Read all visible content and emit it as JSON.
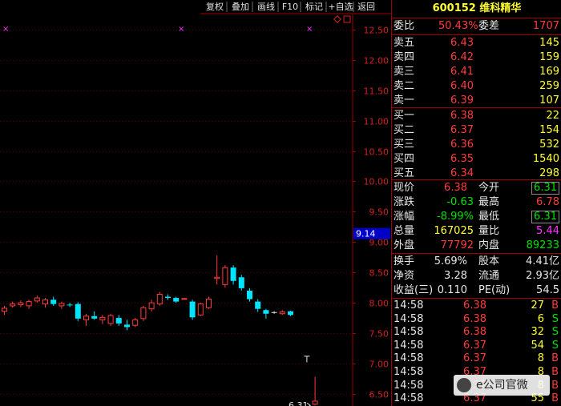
{
  "toolbar": {
    "buttons": [
      "复权",
      "叠加",
      "画线",
      "F10",
      "标记",
      "+自选",
      "返回"
    ],
    "diamond_icon": "diamond-outline-icon"
  },
  "chart_data": {
    "type": "candlestick",
    "y_ticks": [
      "12.50",
      "12.00",
      "11.50",
      "11.00",
      "10.50",
      "10.00",
      "9.50",
      "9.00",
      "8.50",
      "8.00",
      "7.50",
      "7.00",
      "6.50"
    ],
    "ylim": [
      6.3,
      12.75
    ],
    "price_marker": "9.14",
    "price_marker_value": 9.14,
    "low_label": "6.31",
    "low_value": 6.31,
    "candles": [
      {
        "o": 7.86,
        "h": 7.95,
        "l": 7.8,
        "c": 7.91
      },
      {
        "o": 7.95,
        "h": 8.02,
        "l": 7.92,
        "c": 7.98
      },
      {
        "o": 7.97,
        "h": 8.04,
        "l": 7.93,
        "c": 8.0
      },
      {
        "o": 7.95,
        "h": 8.05,
        "l": 7.9,
        "c": 8.02
      },
      {
        "o": 8.03,
        "h": 8.12,
        "l": 8.0,
        "c": 8.08
      },
      {
        "o": 7.98,
        "h": 8.08,
        "l": 7.92,
        "c": 8.05
      },
      {
        "o": 8.05,
        "h": 8.1,
        "l": 7.95,
        "c": 7.98
      },
      {
        "o": 7.95,
        "h": 8.02,
        "l": 7.9,
        "c": 7.99
      },
      {
        "o": 7.97,
        "h": 8.0,
        "l": 7.93,
        "c": 7.96
      },
      {
        "o": 7.98,
        "h": 8.01,
        "l": 7.7,
        "c": 7.74
      },
      {
        "o": 7.72,
        "h": 7.82,
        "l": 7.62,
        "c": 7.78
      },
      {
        "o": 7.78,
        "h": 7.86,
        "l": 7.72,
        "c": 7.74
      },
      {
        "o": 7.72,
        "h": 7.8,
        "l": 7.65,
        "c": 7.76
      },
      {
        "o": 7.66,
        "h": 7.82,
        "l": 7.62,
        "c": 7.79
      },
      {
        "o": 7.75,
        "h": 7.8,
        "l": 7.62,
        "c": 7.66
      },
      {
        "o": 7.64,
        "h": 7.72,
        "l": 7.55,
        "c": 7.6
      },
      {
        "o": 7.63,
        "h": 7.75,
        "l": 7.6,
        "c": 7.72
      },
      {
        "o": 7.74,
        "h": 7.95,
        "l": 7.7,
        "c": 7.92
      },
      {
        "o": 7.9,
        "h": 8.05,
        "l": 7.86,
        "c": 8.0
      },
      {
        "o": 7.98,
        "h": 8.18,
        "l": 7.95,
        "c": 8.14
      },
      {
        "o": 8.1,
        "h": 8.14,
        "l": 8.05,
        "c": 8.08
      },
      {
        "o": 8.08,
        "h": 8.1,
        "l": 8.0,
        "c": 8.02
      },
      {
        "o": 8.06,
        "h": 8.08,
        "l": 8.05,
        "c": 8.07
      },
      {
        "o": 8.02,
        "h": 8.05,
        "l": 7.72,
        "c": 7.76
      },
      {
        "o": 7.8,
        "h": 8.0,
        "l": 7.78,
        "c": 7.98
      },
      {
        "o": 7.92,
        "h": 8.1,
        "l": 7.9,
        "c": 8.06
      },
      {
        "o": 8.4,
        "h": 8.78,
        "l": 8.3,
        "c": 8.42
      },
      {
        "o": 8.3,
        "h": 8.62,
        "l": 8.25,
        "c": 8.58
      },
      {
        "o": 8.58,
        "h": 8.62,
        "l": 8.3,
        "c": 8.36
      },
      {
        "o": 8.42,
        "h": 8.46,
        "l": 8.2,
        "c": 8.24
      },
      {
        "o": 8.2,
        "h": 8.24,
        "l": 8.02,
        "c": 8.06
      },
      {
        "o": 8.02,
        "h": 8.06,
        "l": 7.85,
        "c": 7.9
      },
      {
        "o": 7.88,
        "h": 7.9,
        "l": 7.74,
        "c": 7.82
      },
      {
        "o": 7.84,
        "h": 7.86,
        "l": 7.82,
        "c": 7.84
      },
      {
        "o": 7.82,
        "h": 7.88,
        "l": 7.8,
        "c": 7.85
      },
      {
        "o": 7.86,
        "h": 7.87,
        "l": 7.78,
        "c": 7.8
      },
      null,
      {
        "o": 7.12,
        "h": 7.12,
        "l": 7.02,
        "c": 7.12
      },
      {
        "o": 6.33,
        "h": 6.78,
        "l": 6.31,
        "c": 6.38
      }
    ]
  },
  "quote": {
    "code": "600152",
    "name": "维科精华",
    "weibi_label": "委比",
    "weibi": "50.43%",
    "weicha_label": "委差",
    "weicha": "1707",
    "asks": [
      {
        "label": "卖五",
        "price": "6.43",
        "vol": "145"
      },
      {
        "label": "卖四",
        "price": "6.42",
        "vol": "159"
      },
      {
        "label": "卖三",
        "price": "6.41",
        "vol": "169"
      },
      {
        "label": "卖二",
        "price": "6.40",
        "vol": "259"
      },
      {
        "label": "卖一",
        "price": "6.39",
        "vol": "107"
      }
    ],
    "bids": [
      {
        "label": "买一",
        "price": "6.38",
        "vol": "22"
      },
      {
        "label": "买二",
        "price": "6.37",
        "vol": "154"
      },
      {
        "label": "买三",
        "price": "6.36",
        "vol": "532"
      },
      {
        "label": "买四",
        "price": "6.35",
        "vol": "1540"
      },
      {
        "label": "买五",
        "price": "6.34",
        "vol": "298"
      }
    ],
    "stats": {
      "xianjia_label": "现价",
      "xianjia": "6.38",
      "jinkai_label": "今开",
      "jinkai": "6.31",
      "zhangdie_label": "涨跌",
      "zhangdie": "-0.63",
      "zuigao_label": "最高",
      "zuigao": "6.78",
      "zhangfu_label": "涨幅",
      "zhangfu": "-8.99%",
      "zuidi_label": "最低",
      "zuidi": "6.31",
      "zongliang_label": "总量",
      "zongliang": "167025",
      "liangbi_label": "量比",
      "liangbi": "5.44",
      "waipan_label": "外盘",
      "waipan": "77792",
      "neipan_label": "内盘",
      "neipan": "89233"
    },
    "fund": {
      "huanshou_label": "换手",
      "huanshou": "5.69%",
      "guben_label": "股本",
      "guben": "4.41亿",
      "jingzi_label": "净资",
      "jingzi": "3.28",
      "liutong_label": "流通",
      "liutong": "2.93亿",
      "shouyi_label": "收益(三)",
      "shouyi": "0.110",
      "pe_label": "PE(动)",
      "pe": "54.5"
    },
    "ticks": [
      {
        "time": "14:58",
        "price": "6.38",
        "vol": "27",
        "side": "B"
      },
      {
        "time": "14:58",
        "price": "6.38",
        "vol": "6",
        "side": "S"
      },
      {
        "time": "14:58",
        "price": "6.38",
        "vol": "32",
        "side": "S"
      },
      {
        "time": "14:58",
        "price": "6.37",
        "vol": "54",
        "side": "S"
      },
      {
        "time": "14:58",
        "price": "6.37",
        "vol": "8",
        "side": "B"
      },
      {
        "time": "14:58",
        "price": "6.37",
        "vol": "8",
        "side": "B"
      },
      {
        "time": "14:58",
        "price": "6.37",
        "vol": "8",
        "side": "B"
      },
      {
        "time": "14:58",
        "price": "6.37",
        "vol": "55",
        "side": "B"
      }
    ]
  },
  "watermark": {
    "text": "e公司官微"
  },
  "colors": {
    "up": "#ff3b3b",
    "down": "#00e5ff",
    "frame": "#a00000",
    "flat": "#e8e8e8"
  }
}
